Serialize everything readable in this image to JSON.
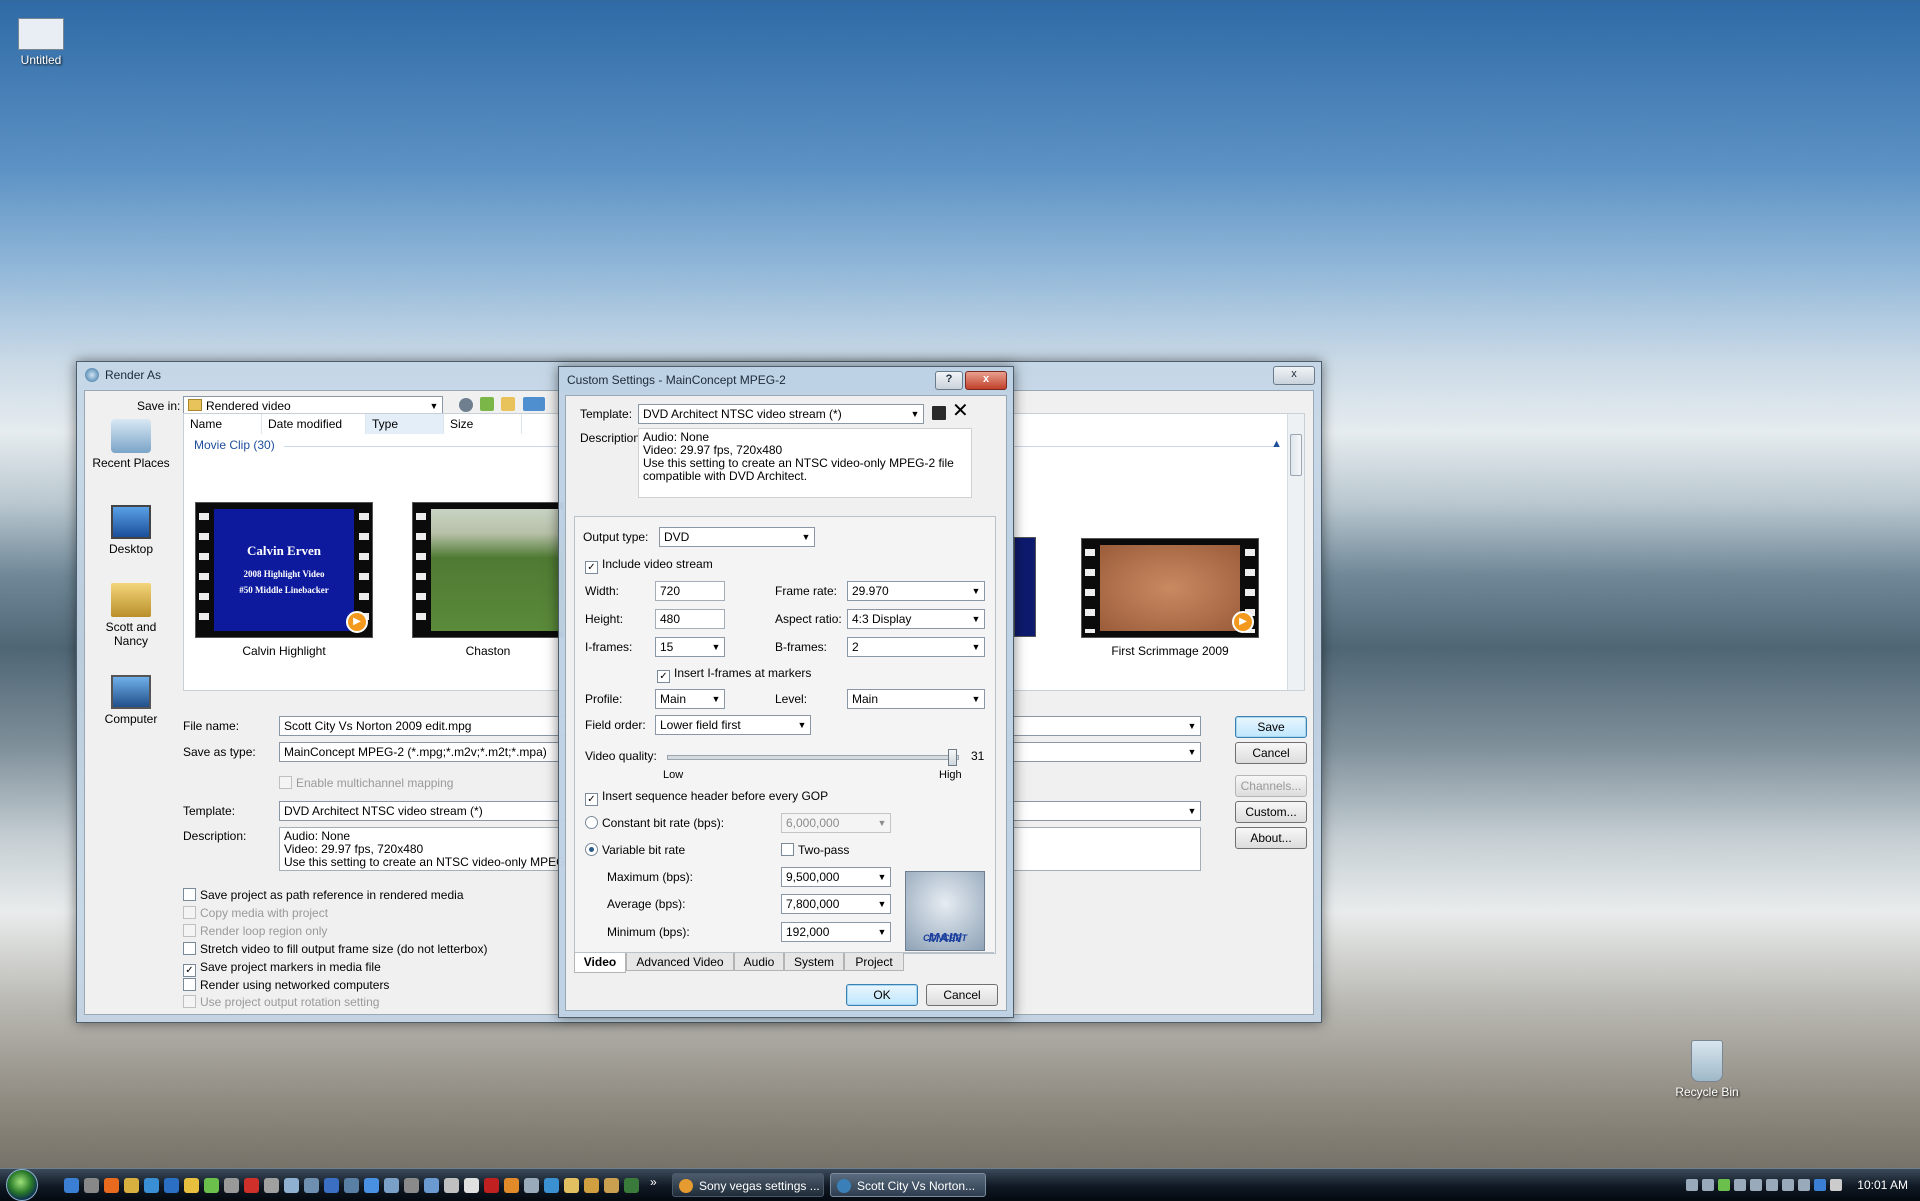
{
  "desktop": {
    "icon_untitled": "Untitled",
    "icon_recycle": "Recycle Bin"
  },
  "render_as": {
    "title": "Render As",
    "close_label": "x",
    "save_in_label": "Save in:",
    "save_in_value": "Rendered video",
    "columns": [
      "Name",
      "Date modified",
      "Type",
      "Size"
    ],
    "group_label": "Movie Clip (30)",
    "places": [
      "Recent Places",
      "Desktop",
      "Scott and Nancy",
      "Computer"
    ],
    "thumbnails": [
      {
        "label": "Calvin Highlight",
        "title_line1": "Calvin Erven",
        "title_line2": "2008 Highlight Video",
        "title_line3": "#50  Middle Linebacker"
      },
      {
        "label": "Chaston"
      },
      {
        "label": "First Scrimmage 2009"
      }
    ],
    "file_name_label": "File name:",
    "file_name_value": "Scott City Vs Norton 2009 edit.mpg",
    "save_as_type_label": "Save as type:",
    "save_as_type_value": "MainConcept MPEG-2 (*.mpg;*.m2v;*.m2t;*.mpa)",
    "enable_multichannel": "Enable multichannel mapping",
    "template_label": "Template:",
    "template_value": "DVD Architect NTSC video stream (*)",
    "description_label": "Description:",
    "description_lines": [
      "Audio: None",
      "Video: 29.97 fps, 720x480",
      "Use this setting to create an NTSC video-only MPEG-2 file"
    ],
    "checkboxes": [
      {
        "label": "Save project as path reference in rendered media",
        "checked": false,
        "disabled": false
      },
      {
        "label": "Copy media with project",
        "checked": false,
        "disabled": true
      },
      {
        "label": "Render loop region only",
        "checked": false,
        "disabled": true
      },
      {
        "label": "Stretch video to fill output frame size (do not letterbox)",
        "checked": false,
        "disabled": false
      },
      {
        "label": "Save project markers in media file",
        "checked": true,
        "disabled": false
      },
      {
        "label": "Render using networked computers",
        "checked": false,
        "disabled": false
      },
      {
        "label": "Use project output rotation setting",
        "checked": false,
        "disabled": true
      }
    ],
    "buttons": {
      "save": "Save",
      "cancel": "Cancel",
      "channels": "Channels...",
      "custom": "Custom...",
      "about": "About..."
    }
  },
  "custom": {
    "title": "Custom Settings - MainConcept MPEG-2",
    "help_label": "?",
    "close_label": "x",
    "template_label": "Template:",
    "template_value": "DVD Architect NTSC video stream (*)",
    "description_label": "Description:",
    "description_lines": [
      "Audio: None",
      "Video: 29.97 fps, 720x480",
      "Use this setting to create an NTSC video-only MPEG-2 file",
      "compatible with DVD Architect."
    ],
    "output_type_label": "Output type:",
    "output_type_value": "DVD",
    "include_video_stream": "Include video stream",
    "width_label": "Width:",
    "width_value": "720",
    "height_label": "Height:",
    "height_value": "480",
    "frame_rate_label": "Frame rate:",
    "frame_rate_value": "29.970",
    "aspect_ratio_label": "Aspect ratio:",
    "aspect_ratio_value": "4:3 Display",
    "iframes_label": "I-frames:",
    "iframes_value": "15",
    "bframes_label": "B-frames:",
    "bframes_value": "2",
    "insert_iframes_markers": "Insert I-frames at markers",
    "profile_label": "Profile:",
    "profile_value": "Main",
    "level_label": "Level:",
    "level_value": "Main",
    "field_order_label": "Field order:",
    "field_order_value": "Lower field first",
    "video_quality_label": "Video quality:",
    "video_quality_value": "31",
    "video_quality_fraction": 1.0,
    "low_label": "Low",
    "high_label": "High",
    "insert_seq_header": "Insert sequence header before every GOP",
    "constant_bitrate_label": "Constant bit rate (bps):",
    "constant_bitrate_value": "6,000,000",
    "variable_bitrate_label": "Variable bit rate",
    "two_pass_label": "Two-pass",
    "maximum_label": "Maximum (bps):",
    "maximum_value": "9,500,000",
    "average_label": "Average (bps):",
    "average_value": "7,800,000",
    "minimum_label": "Minimum (bps):",
    "minimum_value": "192,000",
    "logo_line1": "MAIN",
    "logo_line2": "CONCEPT",
    "tabs": [
      "Video",
      "Advanced Video",
      "Audio",
      "System",
      "Project"
    ],
    "ok_label": "OK",
    "cancel_label": "Cancel"
  },
  "taskbar": {
    "tasks": [
      "Sony vegas settings ...",
      "Scott City Vs Norton..."
    ],
    "clock": "10:01 AM"
  }
}
